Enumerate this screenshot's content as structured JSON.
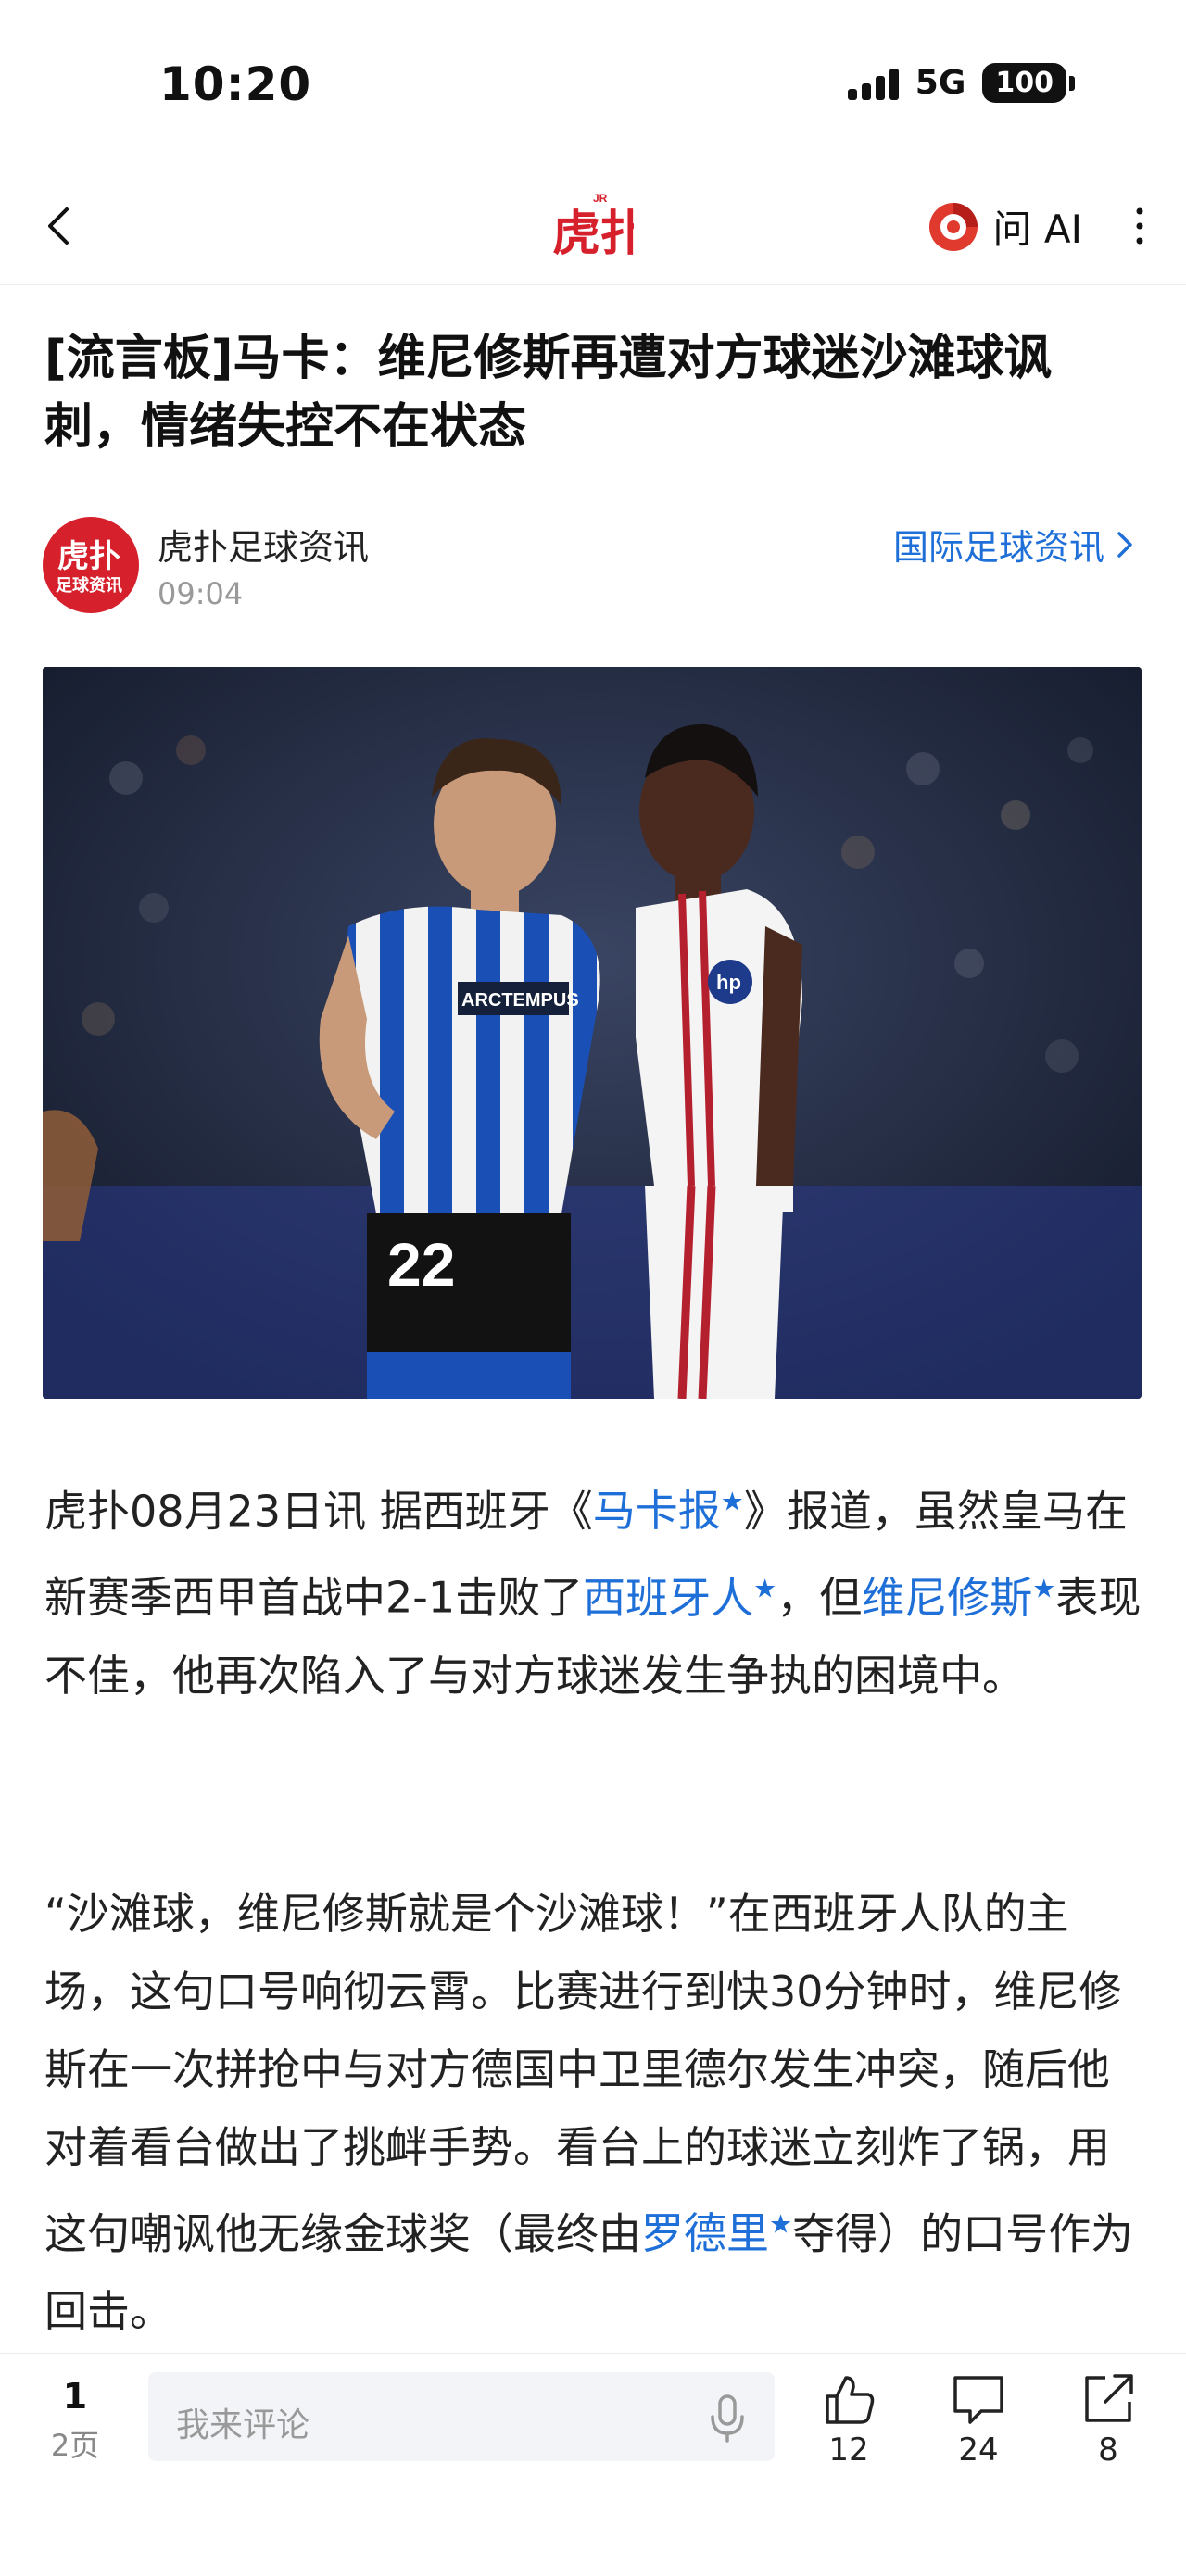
{
  "status_bar": {
    "time": "10:20",
    "network": "5G",
    "battery": "100"
  },
  "nav": {
    "ai_label": "问 AI"
  },
  "article": {
    "title": "[流言板]马卡：维尼修斯再遭对方球迷沙滩球讽刺，情绪失控不在状态",
    "author": "虎扑足球资讯",
    "time": "09:04",
    "category": "国际足球资讯",
    "p1": {
      "t1": "虎扑08月23日讯 据西班牙《",
      "link1": "马卡报",
      "t2": "》报道，虽然皇马在新赛季西甲首战中2-1击败了",
      "link2": "西班牙人",
      "t3": "，但",
      "link3": "维尼修斯",
      "t4": "表现不佳，他再次陷入了与对方球迷发生争执的困境中。"
    },
    "p2": {
      "t1": "“沙滩球，维尼修斯就是个沙滩球！”在西班牙人队的主场，这句口号响彻云霄。比赛进行到快30分钟时，维尼修斯在一次拼抢中与对方德国中卫里德尔发生冲突，随后他对着看台做出了挑衅手势。看台上的球迷立刻炸了锅，用这句嘲讽他无缘金球奖（最终由",
      "link1": "罗德里",
      "t2": "夺得）的口号作为回击。"
    },
    "link_star": "★"
  },
  "image": {
    "jersey_sponsor": "ARCTEMPUS",
    "jersey_number": "22"
  },
  "bottom_bar": {
    "page_current": "1",
    "page_total": "2页",
    "comment_placeholder": "我来评论",
    "likes": "12",
    "comments": "24",
    "shares": "8"
  },
  "colors": {
    "brand_red": "#d6212c",
    "link_blue": "#1f6fd8"
  }
}
